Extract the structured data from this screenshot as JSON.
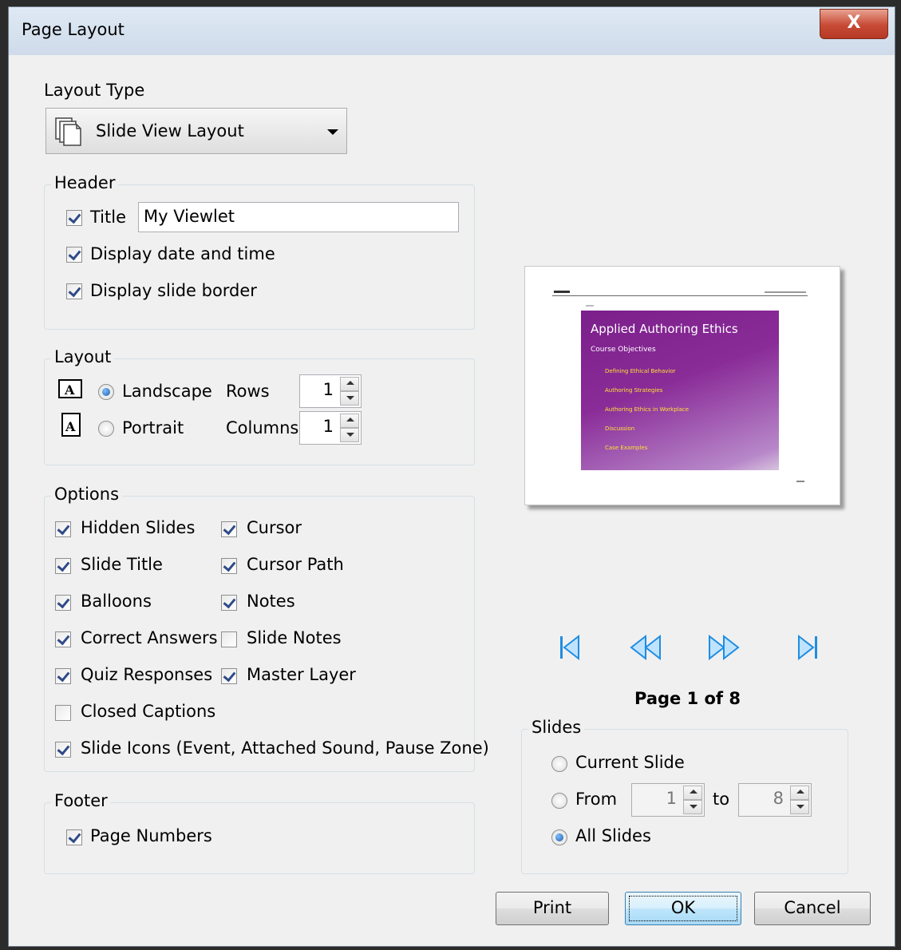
{
  "window": {
    "title": "Page Layout",
    "close_label": "X"
  },
  "layout_type": {
    "label": "Layout Type",
    "selected": "Slide View Layout"
  },
  "header": {
    "group_label": "Header",
    "title_label": "Title",
    "title_value": "My Viewlet",
    "date_label": "Display date and time",
    "border_label": "Display slide border"
  },
  "layout": {
    "group_label": "Layout",
    "landscape_label": "Landscape",
    "portrait_label": "Portrait",
    "rows_label": "Rows",
    "rows_value": "1",
    "columns_label": "Columns",
    "columns_value": "1",
    "orientation": "Landscape"
  },
  "options": {
    "group_label": "Options",
    "items": [
      {
        "label": "Hidden Slides",
        "checked": true
      },
      {
        "label": "Cursor",
        "checked": true
      },
      {
        "label": "Slide Title",
        "checked": true
      },
      {
        "label": "Cursor Path",
        "checked": true
      },
      {
        "label": "Balloons",
        "checked": true
      },
      {
        "label": "Notes",
        "checked": true
      },
      {
        "label": "Correct Answers",
        "checked": true
      },
      {
        "label": "Slide Notes",
        "checked": false
      },
      {
        "label": "Quiz Responses",
        "checked": true
      },
      {
        "label": "Master Layer",
        "checked": true
      },
      {
        "label": "Closed Captions",
        "checked": false
      },
      {
        "label": "Slide Icons (Event, Attached Sound, Pause Zone)",
        "checked": true
      }
    ]
  },
  "footer": {
    "group_label": "Footer",
    "page_numbers_label": "Page Numbers"
  },
  "preview": {
    "slide_title": "Applied Authoring Ethics",
    "slide_subtitle": "Course Objectives",
    "bullets": [
      "Defining Ethical Behavior",
      "Authoring Strategies",
      "Authoring Ethics in Workplace",
      "Discussion",
      "Case Examples"
    ]
  },
  "pager": {
    "text": "Page 1 of 8"
  },
  "slides": {
    "group_label": "Slides",
    "current_label": "Current Slide",
    "from_label": "From",
    "from_value": "1",
    "to_label": "to",
    "to_value": "8",
    "all_label": "All Slides",
    "selected": "All Slides"
  },
  "buttons": {
    "print": "Print",
    "ok": "OK",
    "cancel": "Cancel"
  },
  "colors": {
    "accent": "#1f8de0",
    "slide_bg": "#7b1f8b",
    "bullet": "#ffe033"
  }
}
